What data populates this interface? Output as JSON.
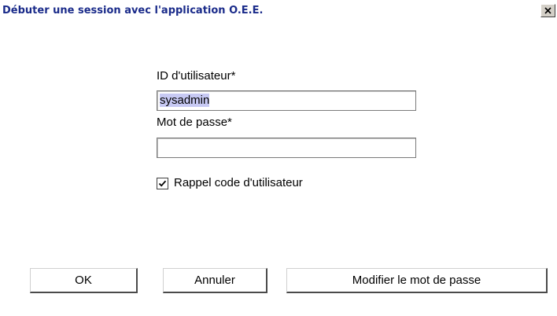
{
  "window": {
    "title": "Débuter une session avec l'application O.E.E."
  },
  "form": {
    "user_id_label": "ID d'utilisateur*",
    "user_id_value": "sysadmin",
    "password_label": "Mot de passe*",
    "password_value": "",
    "remember_label": "Rappel code d'utilisateur",
    "remember_checked": true
  },
  "buttons": {
    "ok": "OK",
    "cancel": "Annuler",
    "change_password": "Modifier le mot de passe"
  },
  "icons": {
    "close": "close-icon",
    "check": "checkmark-icon"
  },
  "colors": {
    "title_text": "#1a2b8a",
    "selection_highlight": "#c7c9f3"
  }
}
